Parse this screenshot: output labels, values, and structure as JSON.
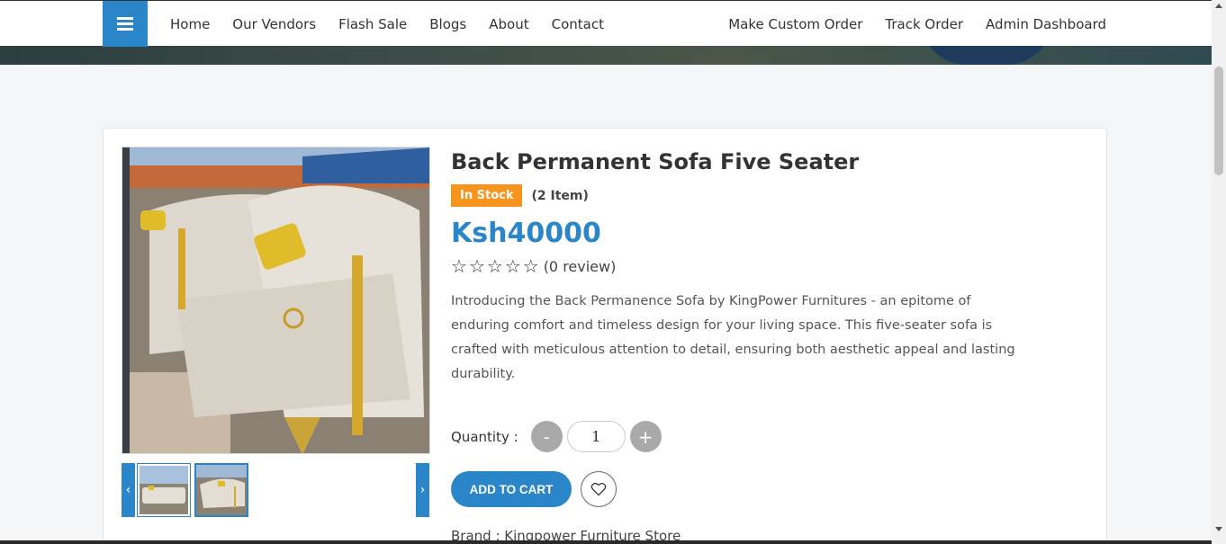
{
  "nav": {
    "left_links": [
      "Home",
      "Our Vendors",
      "Flash Sale",
      "Blogs",
      "About",
      "Contact"
    ],
    "right_links": [
      "Make Custom Order",
      "Track Order",
      "Admin Dashboard"
    ]
  },
  "product": {
    "title": "Back Permanent Sofa Five Seater",
    "stock_badge": "In Stock",
    "stock_count": "(2 Item)",
    "price": "Ksh40000",
    "rating_stars": 0,
    "review_text": "(0 review)",
    "description": "Introducing the Back Permanence Sofa by KingPower Furnitures - an epitome of enduring comfort and timeless design for your living space. This five-seater sofa is crafted with meticulous attention to detail, ensuring both aesthetic appeal and lasting durability.",
    "quantity_label": "Quantity :",
    "quantity_value": "1",
    "minus_label": "-",
    "plus_label": "+",
    "add_to_cart": "ADD TO CART",
    "brand_text": "Brand : Kingpower Furniture Store"
  },
  "gallery": {
    "prev_label": "‹",
    "next_label": "›"
  },
  "colors": {
    "accent": "#2b86c9",
    "stock": "#f7941d"
  }
}
